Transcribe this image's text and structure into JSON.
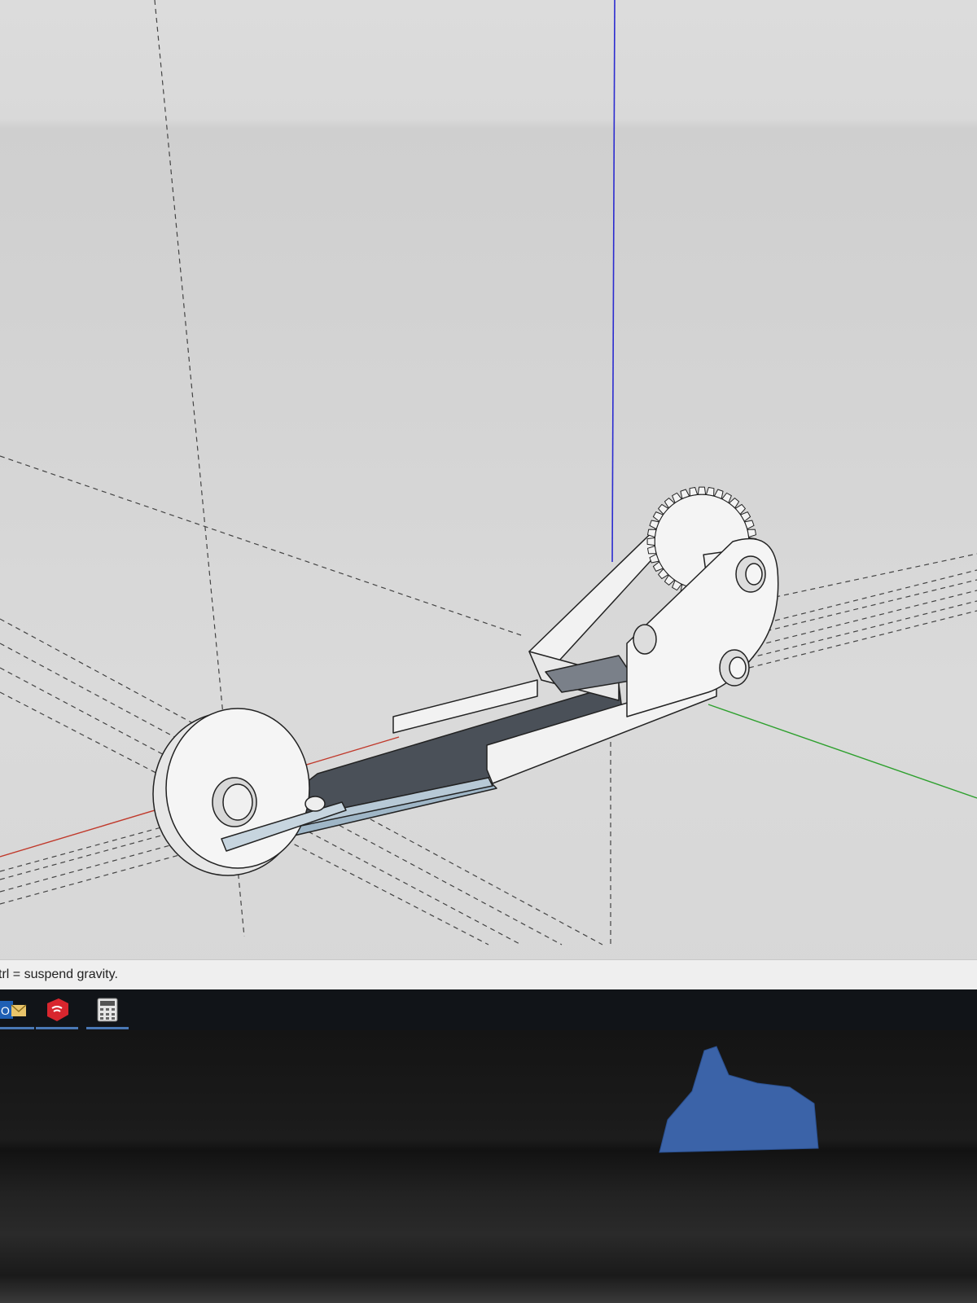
{
  "status_bar": {
    "text": "trl = suspend gravity."
  },
  "taskbar": {
    "items": [
      {
        "icon": "outlook-icon",
        "label": ""
      },
      {
        "icon": "sketchup-icon",
        "label": ""
      },
      {
        "icon": "calculator-icon",
        "label": ""
      }
    ]
  },
  "colors": {
    "viewport_bg": "#d6d6d6",
    "blue_axis": "#2b2bd0",
    "green_axis": "#2ea02e",
    "red_axis": "#c0392b",
    "model_face": "#f2f2f2",
    "model_dark_face": "#4a5058",
    "tape": "#3b63a8"
  }
}
